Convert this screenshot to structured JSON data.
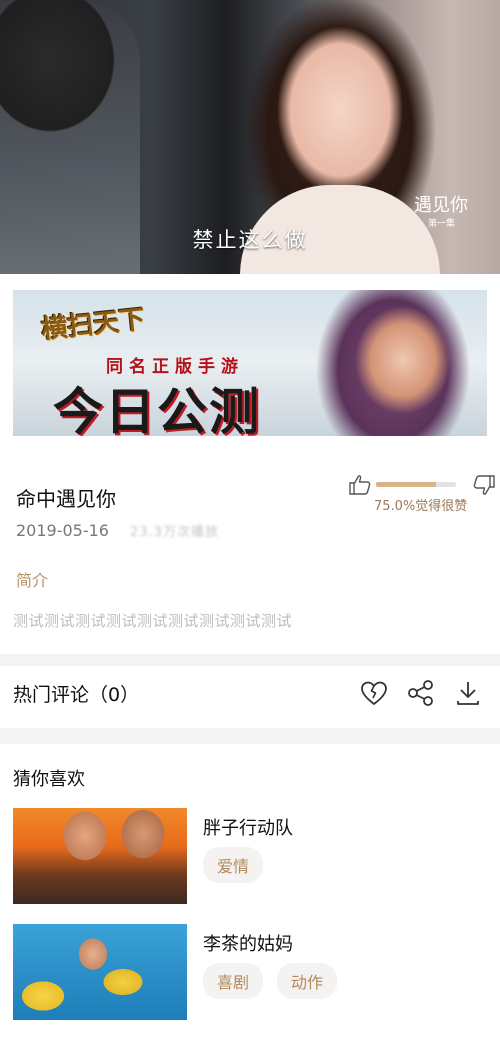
{
  "video": {
    "subtitle": "禁止这么做",
    "logo_title": "遇见你",
    "logo_episode": "第一集"
  },
  "banner": {
    "game_logo": "横扫天下",
    "promo_small": "同名正版手游",
    "promo_big": "今日公测"
  },
  "info": {
    "title": "命中遇见你",
    "rating_fraction": 0.75,
    "rating_text": "75.0%觉得很赞",
    "date": "2019-05-16",
    "blurred_text": "23.3万次播放",
    "intro_label": "简介",
    "intro_text": "测试测试测试测试测试测试测试测试测试"
  },
  "comments": {
    "title": "热门评论（0）"
  },
  "guess": {
    "title": "猜你喜欢",
    "items": [
      {
        "title": "胖子行动队",
        "tags": [
          "爱情"
        ]
      },
      {
        "title": "李茶的姑妈",
        "tags": [
          "喜剧",
          "动作"
        ]
      }
    ]
  },
  "icons": {
    "thumb_up": "thumb-up-icon",
    "thumb_down": "thumb-down-icon",
    "heart": "broken-heart-icon",
    "share": "share-icon",
    "download": "download-icon"
  },
  "colors": {
    "accent": "#b59268",
    "rating_bar": "#d7b48a"
  }
}
